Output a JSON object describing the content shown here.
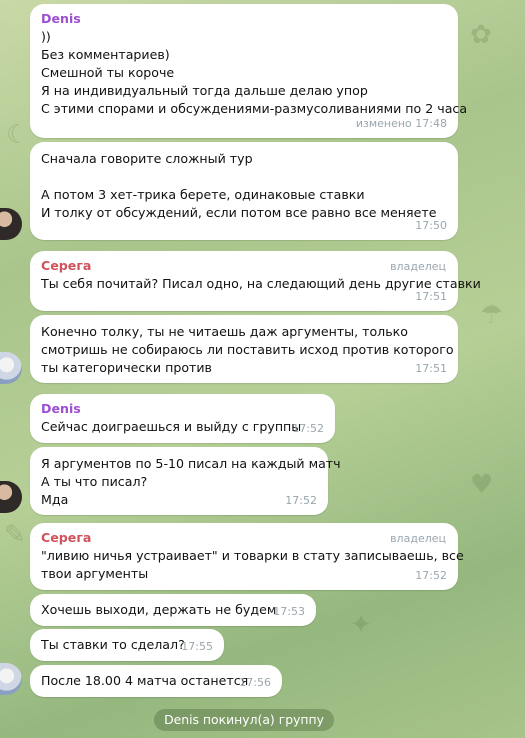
{
  "colors": {
    "denis": "#9c4fd1",
    "serega": "#d0535b",
    "time": "#9aa6ad"
  },
  "messages": [
    {
      "sender": "Denis",
      "lines": [
        "))",
        "Без комментариев)",
        "Смешной ты короче",
        "Я на индивидуальный тогда дальше делаю упор",
        "С этими спорами и обсуждениями-размусоливаниями по 2 часа"
      ],
      "time": "изменено 17:48"
    },
    {
      "lines": [
        "Сначала говорите сложный тур",
        "",
        "А потом 3 хет-трика берете, одинаковые ставки",
        "И толку от обсуждений, если потом все равно все меняете"
      ],
      "time": "17:50"
    },
    {
      "sender": "Серега",
      "role": "владелец",
      "lines": [
        "Ты себя почитай? Писал одно, на следающий день другие ставки"
      ],
      "time": "17:51"
    },
    {
      "lines": [
        "Конечно толку, ты не читаешь даж аргументы, только",
        "смотришь не собираюсь ли поставить исход против которого",
        "ты категорически против"
      ],
      "time": "17:51"
    },
    {
      "sender": "Denis",
      "lines": [
        "Сейчас доиграешься и выйду с группы"
      ],
      "time": "17:52"
    },
    {
      "lines": [
        "Я аргументов по 5-10 писал на каждый матч",
        "А ты что писал?",
        "Мда"
      ],
      "time": "17:52"
    },
    {
      "sender": "Серега",
      "role": "владелец",
      "lines": [
        "\"ливию ничья устраивает\" и товарки в стату записываешь, все",
        "твои аргументы"
      ],
      "time": "17:52"
    },
    {
      "lines": [
        "Хочешь выходи, держать не будем"
      ],
      "time": "17:53"
    },
    {
      "lines": [
        "Ты ставки то сделал?"
      ],
      "time": "17:55"
    },
    {
      "lines": [
        "После 18.00 4 матча останется"
      ],
      "time": "17:56"
    }
  ],
  "service_message": "Denis покинул(а) группу"
}
